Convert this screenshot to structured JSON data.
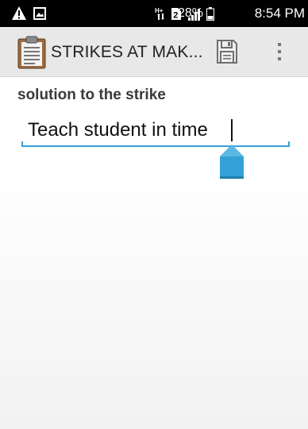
{
  "status_bar": {
    "icons": [
      "alert-icon",
      "image-icon",
      "hplus-network-icon",
      "sim-2-icon",
      "signal-icon",
      "battery-icon"
    ],
    "network_label": "H+",
    "sim_label": "2",
    "battery_percent": "28%",
    "time": "8:54 PM"
  },
  "app_bar": {
    "title": "STRIKES AT MAK...",
    "icons": [
      "clipboard-icon",
      "save-icon",
      "overflow-menu-icon"
    ]
  },
  "form": {
    "label": "solution to the strike",
    "value": "Teach student in time"
  },
  "colors": {
    "status_bar_bg": "#000000",
    "app_bar_bg": "#e8e8e8",
    "accent": "#33a1d6"
  }
}
